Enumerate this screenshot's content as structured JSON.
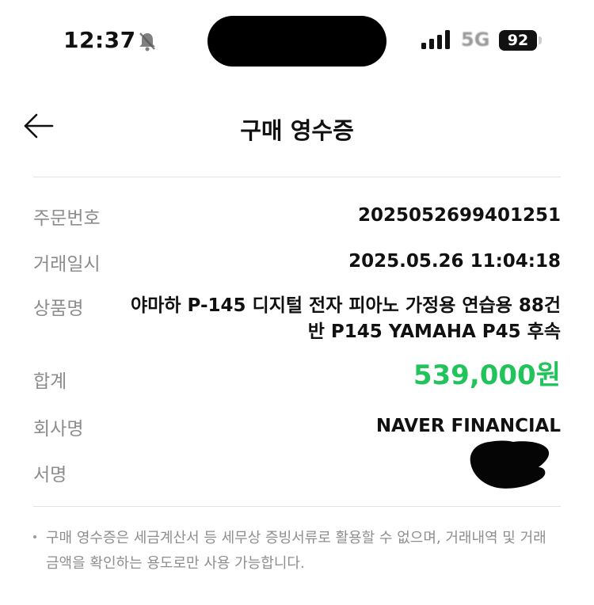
{
  "status_bar": {
    "time": "12:37",
    "network": "5G",
    "battery": "92"
  },
  "header": {
    "title": "구매 영수증"
  },
  "receipt": {
    "order_number_label": "주문번호",
    "order_number": "2025052699401251",
    "datetime_label": "거래일시",
    "datetime": "2025.05.26 11:04:18",
    "product_label": "상품명",
    "product_line1": "야마하 P-145 디지털 전자 피아노 가정용 연습용 88건",
    "product_line2": "반 P145 YAMAHA P45 후속",
    "total_label": "합계",
    "total": "539,000원",
    "company_label": "회사명",
    "company": "NAVER FINANCIAL",
    "signature_label": "서명"
  },
  "notice": {
    "line1": "구매 영수증은 세금계산서 등 세무상 증빙서류로 활용할 수 없으며, 거래내역 및 거래",
    "line2": "금액을 확인하는 용도로만 사용 가능합니다."
  },
  "colors": {
    "total_green": "#20c45a",
    "label_gray": "#8c8c8c"
  }
}
